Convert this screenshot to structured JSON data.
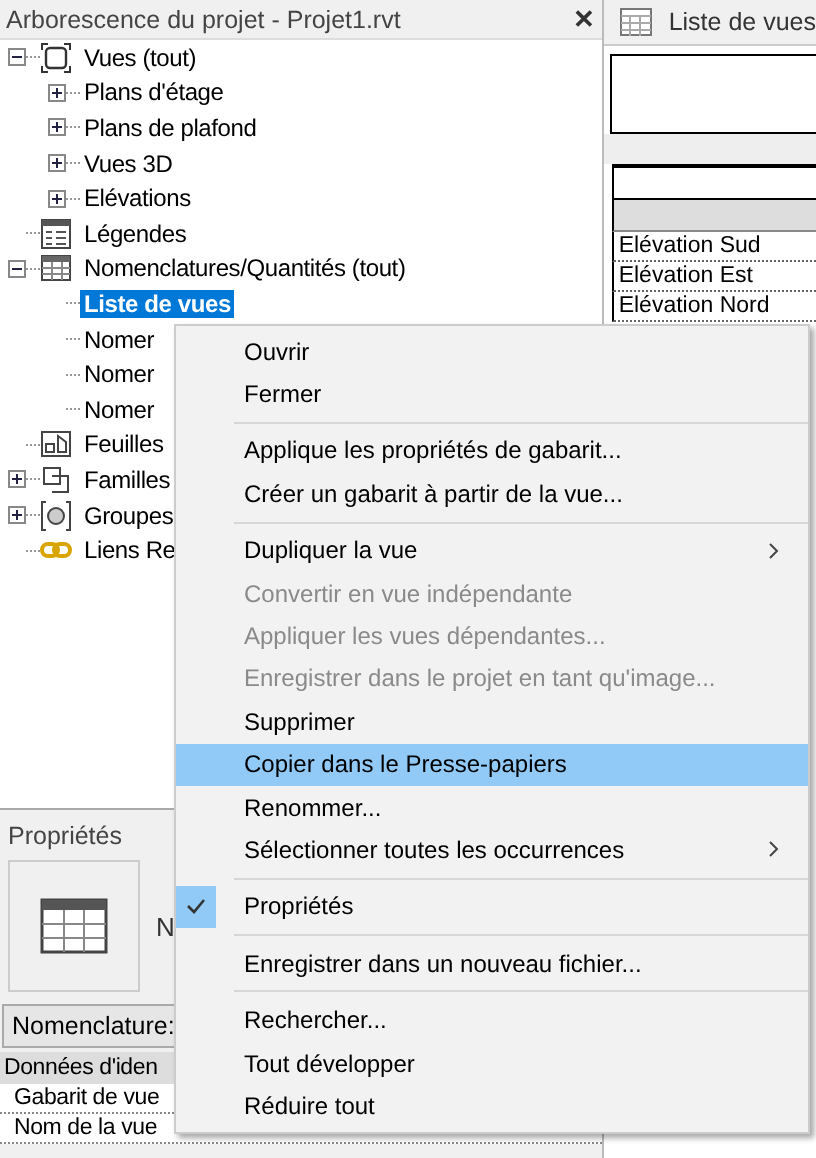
{
  "browser": {
    "title": "Arborescence du projet - Projet1.rvt",
    "close": "✕"
  },
  "tree": [
    {
      "label": "Vues (tout)",
      "kind": "views",
      "expanded": true,
      "selected": false,
      "children": [
        {
          "label": "Plans d'étage",
          "expanded": false,
          "selected": false
        },
        {
          "label": "Plans de plafond",
          "expanded": false,
          "selected": false
        },
        {
          "label": "Vues 3D",
          "expanded": false,
          "selected": false
        },
        {
          "label": "Elévations",
          "expanded": false,
          "selected": false
        }
      ]
    },
    {
      "label": "Légendes",
      "kind": "legend",
      "selected": false
    },
    {
      "label": "Nomenclatures/Quantités (tout)",
      "kind": "schedule",
      "expanded": true,
      "selected": false,
      "children": [
        {
          "label": "Liste de vues",
          "selected": true
        },
        {
          "label": "Nomer",
          "selected": false
        },
        {
          "label": "Nomer",
          "selected": false
        },
        {
          "label": "Nomer",
          "selected": false
        }
      ]
    },
    {
      "label": "Feuilles",
      "kind": "sheet",
      "selected": false
    },
    {
      "label": "Familles",
      "kind": "family",
      "expanded": false,
      "selected": false
    },
    {
      "label": "Groupes",
      "kind": "group",
      "expanded": false,
      "selected": false
    },
    {
      "label": "Liens Re",
      "kind": "link",
      "selected": false
    }
  ],
  "properties": {
    "title": "Propriétés",
    "type_name": "N",
    "type_selector": "Nomenclature:",
    "group": "Données d'iden",
    "rows": [
      "Gabarit de vue",
      "Nom de la vue"
    ]
  },
  "view_tab": {
    "title": "Liste de vues"
  },
  "schedule": {
    "rows": [
      "Elévation Sud",
      "Elévation Est",
      "Elévation Nord"
    ]
  },
  "context_menu": [
    {
      "kind": "item",
      "label": "Ouvrir",
      "disabled": false,
      "selected": false,
      "checked": false,
      "submenu": false
    },
    {
      "kind": "item",
      "label": "Fermer",
      "disabled": false,
      "selected": false,
      "checked": false,
      "submenu": false
    },
    {
      "kind": "separator"
    },
    {
      "kind": "item",
      "label": "Applique les propriétés de gabarit...",
      "disabled": false,
      "selected": false,
      "checked": false,
      "submenu": false
    },
    {
      "kind": "item",
      "label": "Créer un gabarit à partir de la vue...",
      "disabled": false,
      "selected": false,
      "checked": false,
      "submenu": false
    },
    {
      "kind": "separator"
    },
    {
      "kind": "item",
      "label": "Dupliquer la vue",
      "disabled": false,
      "selected": false,
      "checked": false,
      "submenu": true
    },
    {
      "kind": "item",
      "label": "Convertir en vue indépendante",
      "disabled": true,
      "selected": false,
      "checked": false,
      "submenu": false
    },
    {
      "kind": "item",
      "label": "Appliquer les vues dépendantes...",
      "disabled": true,
      "selected": false,
      "checked": false,
      "submenu": false
    },
    {
      "kind": "item",
      "label": "Enregistrer dans le projet en tant qu'image...",
      "disabled": true,
      "selected": false,
      "checked": false,
      "submenu": false
    },
    {
      "kind": "item",
      "label": "Supprimer",
      "disabled": false,
      "selected": false,
      "checked": false,
      "submenu": false
    },
    {
      "kind": "item",
      "label": "Copier dans le Presse-papiers",
      "disabled": false,
      "selected": true,
      "checked": false,
      "submenu": false
    },
    {
      "kind": "item",
      "label": "Renommer...",
      "disabled": false,
      "selected": false,
      "checked": false,
      "submenu": false
    },
    {
      "kind": "item",
      "label": "Sélectionner toutes les occurrences",
      "disabled": false,
      "selected": false,
      "checked": false,
      "submenu": true
    },
    {
      "kind": "separator"
    },
    {
      "kind": "item",
      "label": "Propriétés",
      "disabled": false,
      "selected": false,
      "checked": true,
      "submenu": false
    },
    {
      "kind": "separator"
    },
    {
      "kind": "item",
      "label": "Enregistrer dans un nouveau fichier...",
      "disabled": false,
      "selected": false,
      "checked": false,
      "submenu": false
    },
    {
      "kind": "separator"
    },
    {
      "kind": "item",
      "label": "Rechercher...",
      "disabled": false,
      "selected": false,
      "checked": false,
      "submenu": false
    },
    {
      "kind": "item",
      "label": "Tout développer",
      "disabled": false,
      "selected": false,
      "checked": false,
      "submenu": false
    },
    {
      "kind": "item",
      "label": "Réduire tout",
      "disabled": false,
      "selected": false,
      "checked": false,
      "submenu": false
    }
  ]
}
